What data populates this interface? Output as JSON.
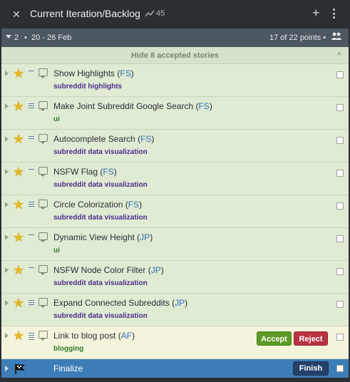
{
  "header": {
    "close_icon": "close-icon",
    "title": "Current Iteration/Backlog",
    "velocity": "45",
    "velocity_icon": "velocity-icon",
    "add_icon": "plus-icon",
    "more_icon": "more-vertical-icon"
  },
  "iteration": {
    "number": "2",
    "separator": "•",
    "dates": "20 - 26 Feb",
    "points": "17 of 22 points",
    "team_separator": "•"
  },
  "accepted_toggle": {
    "label": "Hide 8 accepted stories",
    "chevron": "^"
  },
  "stories": [
    {
      "name": "Show Highlights",
      "owner": "FS",
      "label": "subreddit highlights",
      "estimate": 1
    },
    {
      "name": "Make Joint Subreddit Google Search",
      "owner": "FS",
      "label": "ui",
      "estimate": 3
    },
    {
      "name": "Autocomplete Search",
      "owner": "FS",
      "label": "subreddit data visualization",
      "estimate": 2
    },
    {
      "name": "NSFW Flag",
      "owner": "FS",
      "label": "subreddit data visualization",
      "estimate": 1
    },
    {
      "name": "Circle Colorization",
      "owner": "FS",
      "label": "subreddit data visualization",
      "estimate": 3
    },
    {
      "name": "Dynamic View Height",
      "owner": "JP",
      "label": "ui",
      "estimate": 1
    },
    {
      "name": "NSFW Node Color Filter",
      "owner": "JP",
      "label": "subreddit data visualization",
      "estimate": 1
    },
    {
      "name": "Expand Connected Subreddits",
      "owner": "JP",
      "label": "subreddit data visualization",
      "estimate": 3
    }
  ],
  "delivered_story": {
    "name": "Link to blog post",
    "owner": "AF",
    "label": "blogging",
    "estimate": 5,
    "accept_label": "Accept",
    "reject_label": "Reject"
  },
  "release": {
    "name": "Finalize",
    "finish_label": "Finish"
  },
  "colors": {
    "accepted_bg": "#e0ebd4",
    "delivered_bg": "#f4f4dc",
    "release_bg": "#3d7db7",
    "label_purple": "#4b2f8a",
    "label_green": "#2d7a2a",
    "owner_blue": "#2f6db5",
    "accept_green": "#5b9a24",
    "reject_red": "#b8323f"
  }
}
